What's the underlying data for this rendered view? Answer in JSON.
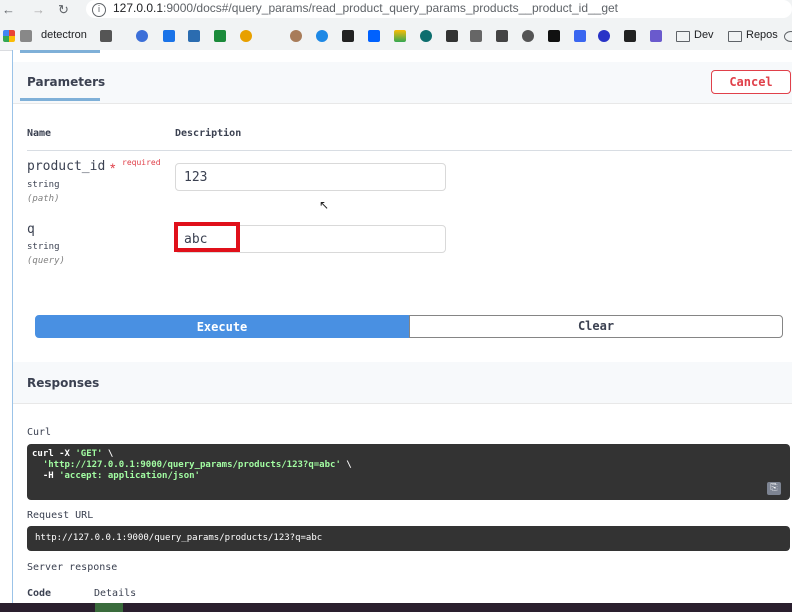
{
  "browser": {
    "url_host": "127.0.0.1",
    "url_rest": ":9000/docs#/query_params/read_product_query_params_products__product_id__get",
    "bookmarks": [
      {
        "label": "detectron"
      },
      {
        "label": "Dev"
      },
      {
        "label": "Repos"
      }
    ]
  },
  "params": {
    "tab_label": "Parameters",
    "cancel_label": "Cancel",
    "col_name": "Name",
    "col_description": "Description",
    "rows": [
      {
        "name": "product_id",
        "required_star": "*",
        "required_label": "required",
        "type": "string",
        "in": "(path)",
        "value": "123"
      },
      {
        "name": "q",
        "type": "string",
        "in": "(query)",
        "value": "abc"
      }
    ],
    "execute_label": "Execute",
    "clear_label": "Clear"
  },
  "responses": {
    "title": "Responses",
    "curl_label": "Curl",
    "curl": {
      "l1_a": "curl -X ",
      "l1_b": "'GET'",
      "l1_c": " \\",
      "l2_a": "  ",
      "l2_b": "'http://127.0.0.1:9000/query_params/products/123?q=abc'",
      "l2_c": " \\",
      "l3_a": "  -H ",
      "l3_b": "'accept: application/json'"
    },
    "request_url_label": "Request URL",
    "request_url": "http://127.0.0.1:9000/query_params/products/123?q=abc",
    "server_response_label": "Server response",
    "code_label": "Code",
    "details_label": "Details"
  }
}
